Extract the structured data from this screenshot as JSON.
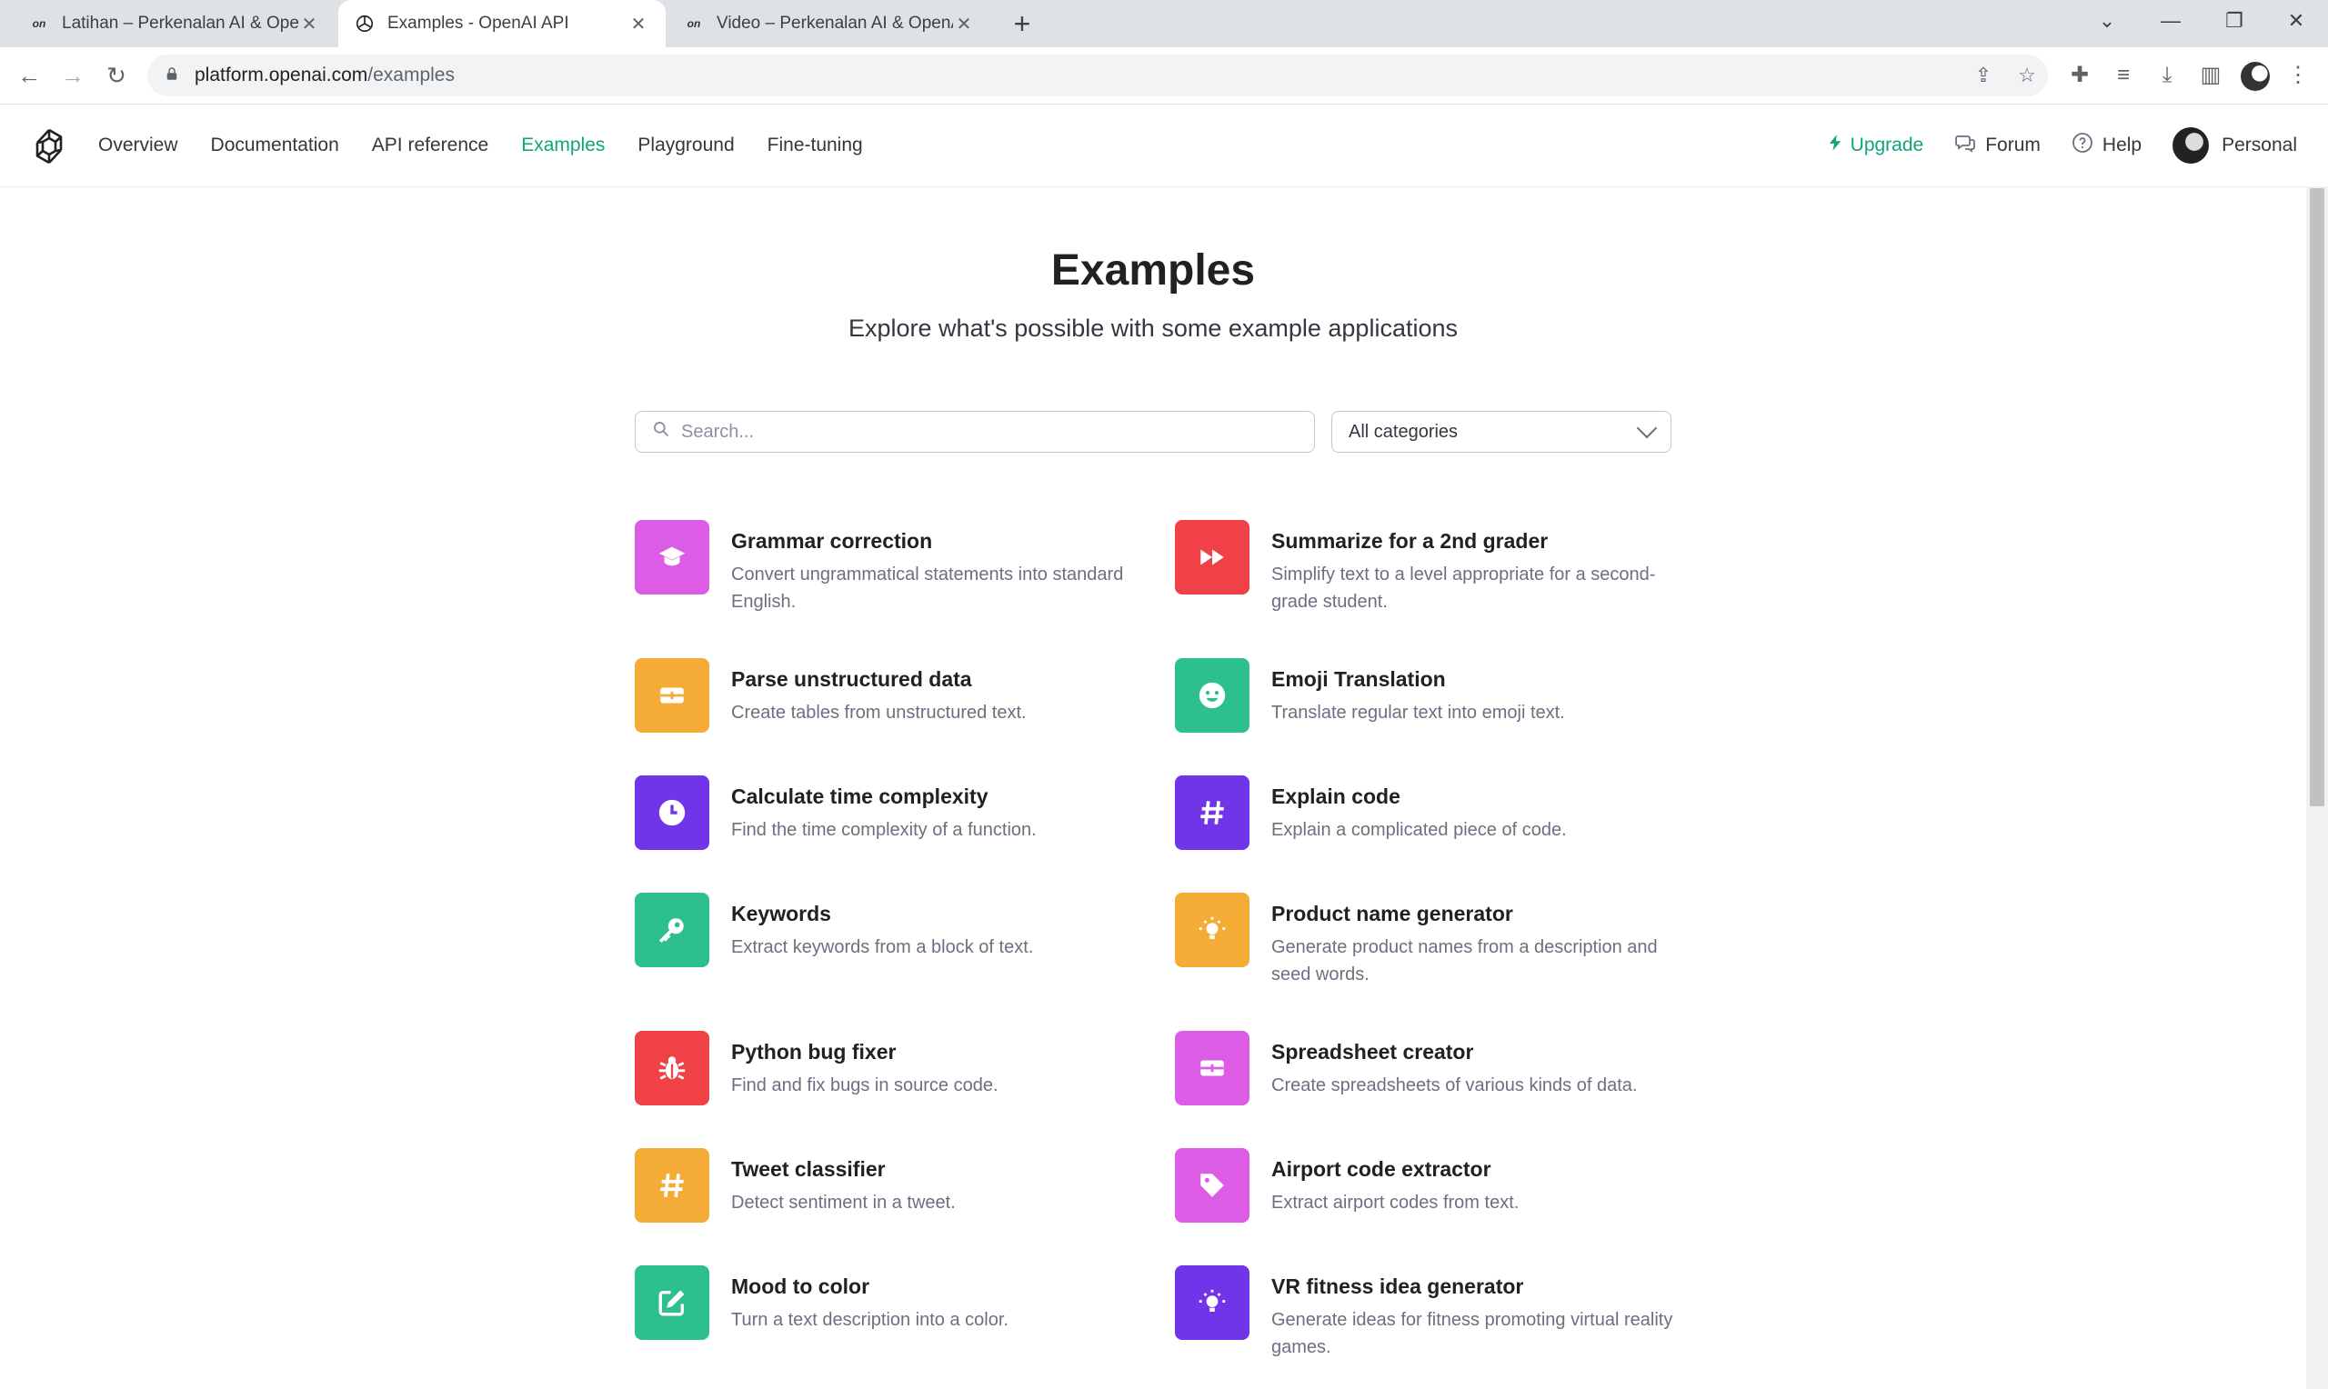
{
  "browser": {
    "tabs": [
      {
        "title": "Latihan – Perkenalan AI & OpenAI",
        "favicon": "on"
      },
      {
        "title": "Examples - OpenAI API",
        "favicon": "openai-logo"
      },
      {
        "title": "Video – Perkenalan AI & OpenAI",
        "favicon": "on"
      }
    ],
    "url_host": "platform.openai.com",
    "url_path": "/examples"
  },
  "header": {
    "nav": [
      "Overview",
      "Documentation",
      "API reference",
      "Examples",
      "Playground",
      "Fine-tuning"
    ],
    "active_nav": "Examples",
    "upgrade": "Upgrade",
    "forum": "Forum",
    "help": "Help",
    "account": "Personal"
  },
  "main": {
    "title": "Examples",
    "subtitle": "Explore what's possible with some example applications",
    "search_placeholder": "Search...",
    "category": "All categories",
    "examples": [
      {
        "title": "Grammar correction",
        "desc": "Convert ungrammatical statements into standard English.",
        "icon": "graduation-cap",
        "color": "#dd5ce5"
      },
      {
        "title": "Summarize for a 2nd grader",
        "desc": "Simplify text to a level appropriate for a second-grade student.",
        "icon": "fast-forward",
        "color": "#ef4146"
      },
      {
        "title": "Parse unstructured data",
        "desc": "Create tables from unstructured text.",
        "icon": "table",
        "color": "#f4ac36"
      },
      {
        "title": "Emoji Translation",
        "desc": "Translate regular text into emoji text.",
        "icon": "smiley",
        "color": "#2dc08d"
      },
      {
        "title": "Calculate time complexity",
        "desc": "Find the time complexity of a function.",
        "icon": "clock",
        "color": "#7035e9"
      },
      {
        "title": "Explain code",
        "desc": "Explain a complicated piece of code.",
        "icon": "hashtag",
        "color": "#7035e9"
      },
      {
        "title": "Keywords",
        "desc": "Extract keywords from a block of text.",
        "icon": "key",
        "color": "#2dc08d"
      },
      {
        "title": "Product name generator",
        "desc": "Generate product names from a description and seed words.",
        "icon": "lightbulb",
        "color": "#f4ac36"
      },
      {
        "title": "Python bug fixer",
        "desc": "Find and fix bugs in source code.",
        "icon": "bug",
        "color": "#ef4146"
      },
      {
        "title": "Spreadsheet creator",
        "desc": "Create spreadsheets of various kinds of data.",
        "icon": "table",
        "color": "#dd5ce5"
      },
      {
        "title": "Tweet classifier",
        "desc": "Detect sentiment in a tweet.",
        "icon": "hashtag",
        "color": "#f4ac36"
      },
      {
        "title": "Airport code extractor",
        "desc": "Extract airport codes from text.",
        "icon": "tag",
        "color": "#dd5ce5"
      },
      {
        "title": "Mood to color",
        "desc": "Turn a text description into a color.",
        "icon": "edit",
        "color": "#2dc08d"
      },
      {
        "title": "VR fitness idea generator",
        "desc": "Generate ideas for fitness promoting virtual reality games.",
        "icon": "lightbulb",
        "color": "#7035e9"
      }
    ]
  }
}
